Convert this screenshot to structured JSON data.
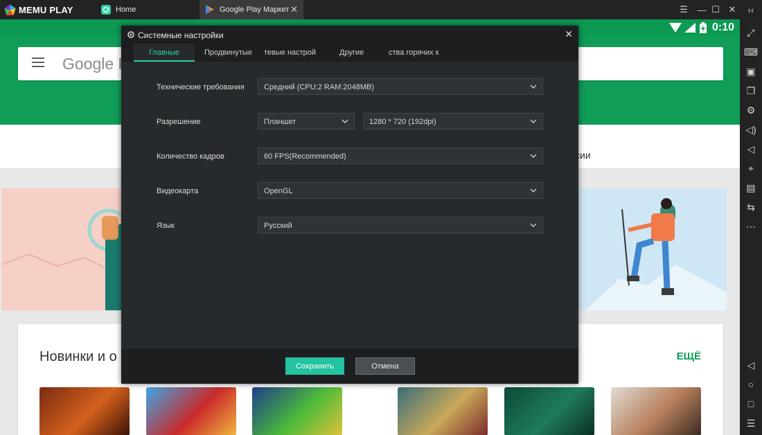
{
  "app": {
    "name": "MEMU PLAY"
  },
  "tabs": [
    {
      "label": "Home"
    },
    {
      "label": "Google Play Маркет"
    }
  ],
  "statusbar": {
    "clock": "0:10"
  },
  "google_play": {
    "logo_text": "Google P",
    "tab_label": "сии",
    "section_title": "Новинки и о",
    "more_label": "ЕЩЁ"
  },
  "dialog": {
    "title": "Системные настройки",
    "tabs": [
      {
        "label": "Главные",
        "active": true
      },
      {
        "label": "Продвинутые"
      },
      {
        "label": "тевые настрой"
      },
      {
        "label": "Другие"
      },
      {
        "label": "ства горячих кл"
      }
    ],
    "fields": {
      "performance": {
        "label": "Технические требования",
        "value": "Средний (CPU:2 RAM:2048MB)"
      },
      "resolution": {
        "label": "Разрешение",
        "mode": "Планшет",
        "value": "1280 * 720 (192dpi)"
      },
      "fps": {
        "label": "Количество кадров",
        "value": "60 FPS(Recommended)"
      },
      "graphics": {
        "label": "Видеокарта",
        "value": "OpenGL"
      },
      "language": {
        "label": "Язык",
        "value": "Русский"
      }
    },
    "buttons": {
      "save": "Сохранить",
      "cancel": "Отмена"
    }
  },
  "colors": {
    "accent": "#2fd2a6",
    "play_green": "#109d58",
    "save_button": "#24c2a0"
  }
}
